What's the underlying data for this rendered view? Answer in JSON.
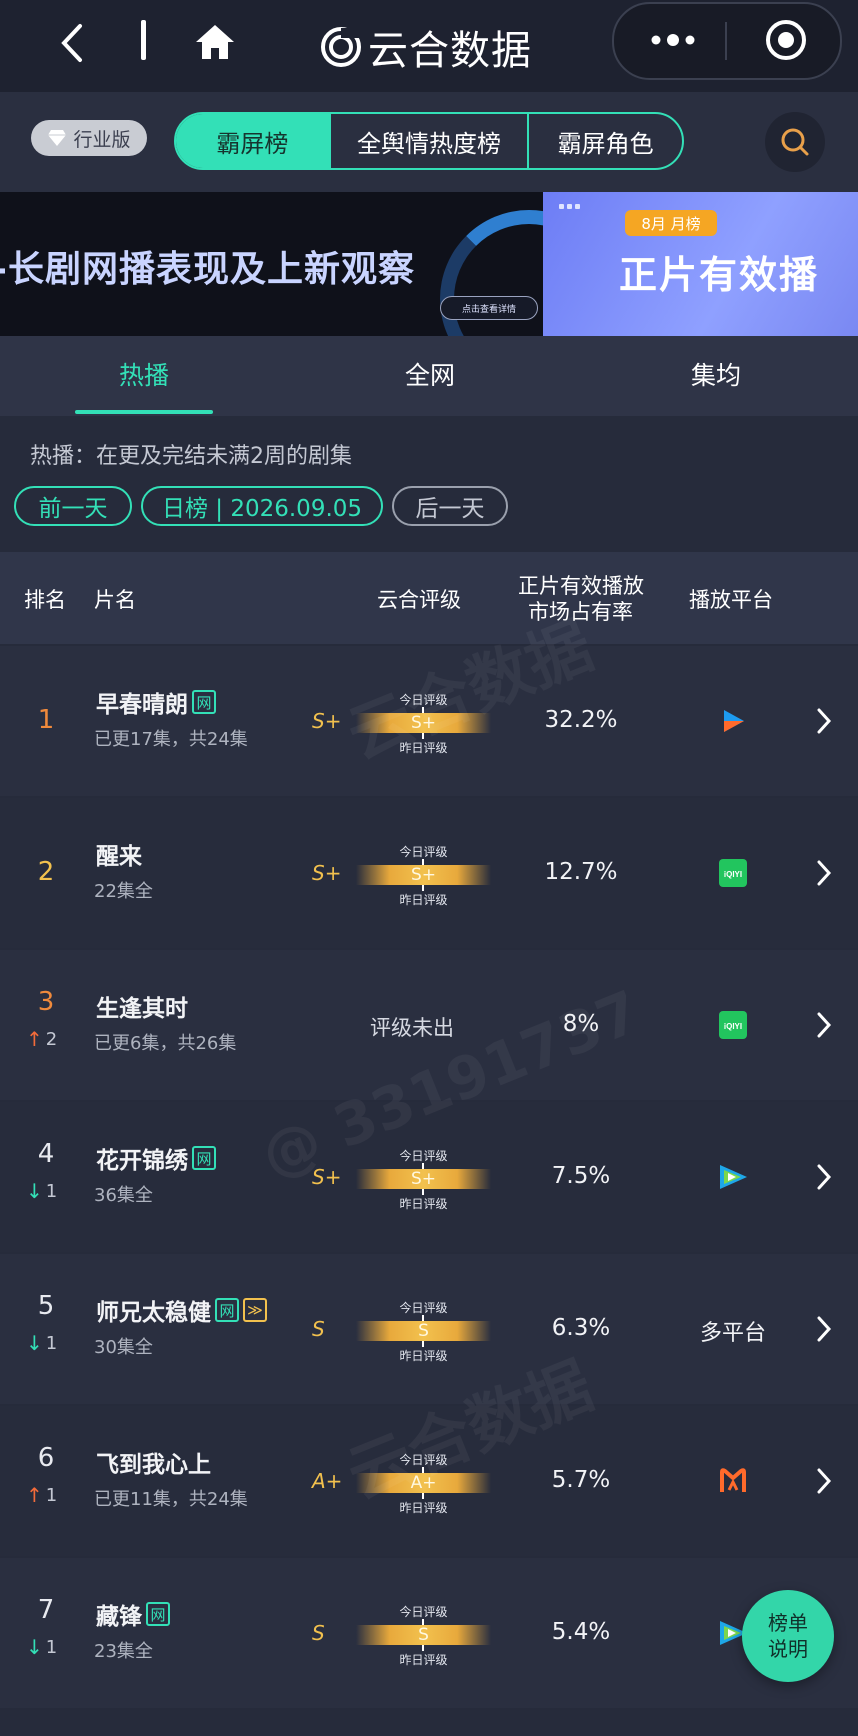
{
  "app": {
    "title": "云合数据"
  },
  "toolbar": {
    "edition": "行业版",
    "segments": [
      "霸屏榜",
      "全舆情热度榜",
      "霸屏角色"
    ]
  },
  "banner": {
    "left_title": "-长剧网播表现及上新观察",
    "left_cta": "点击查看详情",
    "right_pill": "8月 月榜",
    "right_title": "正片有效播"
  },
  "tabs": [
    "热播",
    "全网",
    "集均"
  ],
  "filter": {
    "desc": "热播：在更及完结未满2周的剧集",
    "prev": "前一天",
    "current": "日榜 | 2026.09.05",
    "next": "后一天"
  },
  "table": {
    "headers": {
      "rank": "排名",
      "name": "片名",
      "grade": "云合评级",
      "share_line1": "正片有效播放",
      "share_line2": "市场占有率",
      "platform": "播放平台"
    },
    "gauge_labels": {
      "today": "今日评级",
      "yesterday": "昨日评级"
    },
    "no_grade": "评级未出",
    "rows": [
      {
        "rank": "1",
        "trend": "",
        "trend_dir": "",
        "name": "早春晴朗",
        "tags": [
          "网"
        ],
        "sub": "已更17集，共24集",
        "yesterday_grade": "S+",
        "today_grade": "S+",
        "share": "32.2%",
        "platform_icon": "youku-icon",
        "platform_text": ""
      },
      {
        "rank": "2",
        "trend": "",
        "trend_dir": "",
        "name": "醒来",
        "tags": [],
        "sub": "22集全",
        "yesterday_grade": "S+",
        "today_grade": "S+",
        "share": "12.7%",
        "platform_icon": "iqiyi-icon",
        "platform_text": ""
      },
      {
        "rank": "3",
        "trend": "2",
        "trend_dir": "up",
        "name": "生逢其时",
        "tags": [],
        "sub": "已更6集，共26集",
        "yesterday_grade": "",
        "today_grade": "",
        "share": "8%",
        "platform_icon": "iqiyi-icon",
        "platform_text": ""
      },
      {
        "rank": "4",
        "trend": "1",
        "trend_dir": "down",
        "name": "花开锦绣",
        "tags": [
          "网"
        ],
        "sub": "36集全",
        "yesterday_grade": "S+",
        "today_grade": "S+",
        "share": "7.5%",
        "platform_icon": "tencent-video-icon",
        "platform_text": ""
      },
      {
        "rank": "5",
        "trend": "1",
        "trend_dir": "down",
        "name": "师兄太稳健",
        "tags": [
          "网",
          "≫"
        ],
        "sub": "30集全",
        "yesterday_grade": "S",
        "today_grade": "S",
        "share": "6.3%",
        "platform_icon": "",
        "platform_text": "多平台"
      },
      {
        "rank": "6",
        "trend": "1",
        "trend_dir": "up",
        "name": "飞到我心上",
        "tags": [],
        "sub": "已更11集，共24集",
        "yesterday_grade": "A+",
        "today_grade": "A+",
        "share": "5.7%",
        "platform_icon": "mgtv-icon",
        "platform_text": ""
      },
      {
        "rank": "7",
        "trend": "1",
        "trend_dir": "down",
        "name": "藏锋",
        "tags": [
          "网"
        ],
        "sub": "23集全",
        "yesterday_grade": "S",
        "today_grade": "S",
        "share": "5.4%",
        "platform_icon": "tencent-video-icon",
        "platform_text": ""
      }
    ]
  },
  "fab": {
    "line1": "榜单",
    "line2": "说明"
  },
  "watermark": {
    "brand": "云合数据",
    "handle": "@ 33191737"
  },
  "colors": {
    "accent": "#33e0b7",
    "gold": "#f2c14e",
    "bg": "#262b3b",
    "up": "#f26b3a"
  }
}
